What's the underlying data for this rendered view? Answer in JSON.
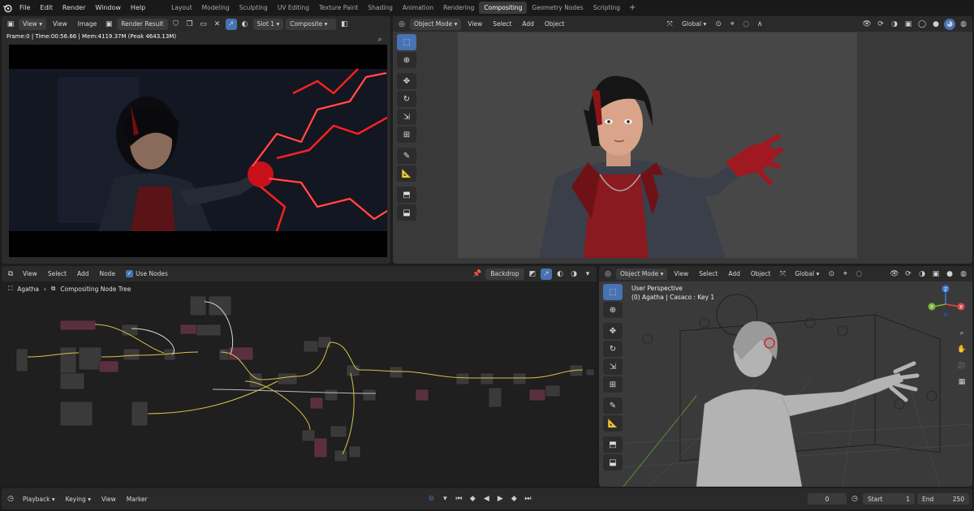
{
  "menu": [
    "File",
    "Edit",
    "Render",
    "Window",
    "Help"
  ],
  "workspaces": [
    "Layout",
    "Modeling",
    "Sculpting",
    "UV Editing",
    "Texture Paint",
    "Shading",
    "Animation",
    "Rendering",
    "Compositing",
    "Geometry Nodes",
    "Scripting"
  ],
  "active_workspace": "Compositing",
  "workspace_add": "+",
  "image_editor": {
    "view": "View",
    "menu_view": "View",
    "menu_image": "Image",
    "image_name": "Render Result",
    "slot": "Slot 1",
    "layer": "Composite",
    "stats": "Frame:0 | Time:00:56.66 | Mem:4119.37M (Peak 4643.13M)"
  },
  "viewport_top": {
    "mode": "Object Mode",
    "menu": [
      "View",
      "Select",
      "Add",
      "Object"
    ],
    "orientation": "Global"
  },
  "node_editor": {
    "menu": [
      "View",
      "Select",
      "Add",
      "Node"
    ],
    "use_nodes_label": "Use Nodes",
    "backdrop": "Backdrop",
    "breadcrumb_object": "Agatha",
    "breadcrumb_tree": "Compositing Node Tree"
  },
  "viewport_bottom": {
    "mode": "Object Mode",
    "menu": [
      "View",
      "Select",
      "Add",
      "Object"
    ],
    "orientation": "Global",
    "info_line1": "User Perspective",
    "info_line2": "(0) Agatha | Casaco : Key 1",
    "gizmo_labels": [
      "Z",
      "X",
      "Y"
    ]
  },
  "timeline": {
    "menu": [
      "Playback",
      "Keying",
      "View",
      "Marker"
    ],
    "current_frame": "0",
    "start_label": "Start",
    "start": "1",
    "end_label": "End",
    "end": "250"
  },
  "colors": {
    "accent": "#4772b3",
    "link_yellow": "#d6c34a",
    "lightning_red": "#ff1a1a"
  }
}
